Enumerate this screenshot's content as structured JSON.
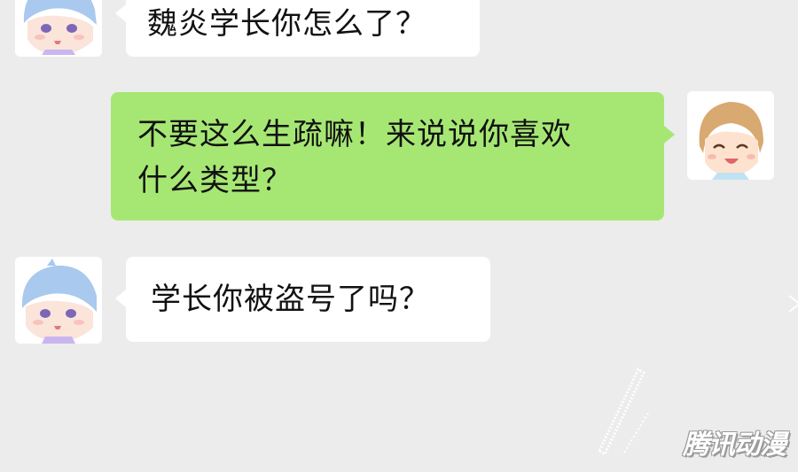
{
  "messages": [
    {
      "side": "left",
      "avatar": "boy-blue-hair-avatar",
      "text": "魏炎学长你怎么了？"
    },
    {
      "side": "right",
      "avatar": "boy-brown-hair-avatar",
      "line1": "不要这么生疏嘛！来说说你喜欢",
      "line2": "什么类型？"
    },
    {
      "side": "left",
      "avatar": "boy-blue-hair-avatar",
      "text": "学长你被盗号了吗？"
    }
  ],
  "watermark": "腾讯动漫",
  "colors": {
    "background": "#ececec",
    "outgoing_bubble": "#a6e774",
    "incoming_bubble": "#ffffff"
  }
}
